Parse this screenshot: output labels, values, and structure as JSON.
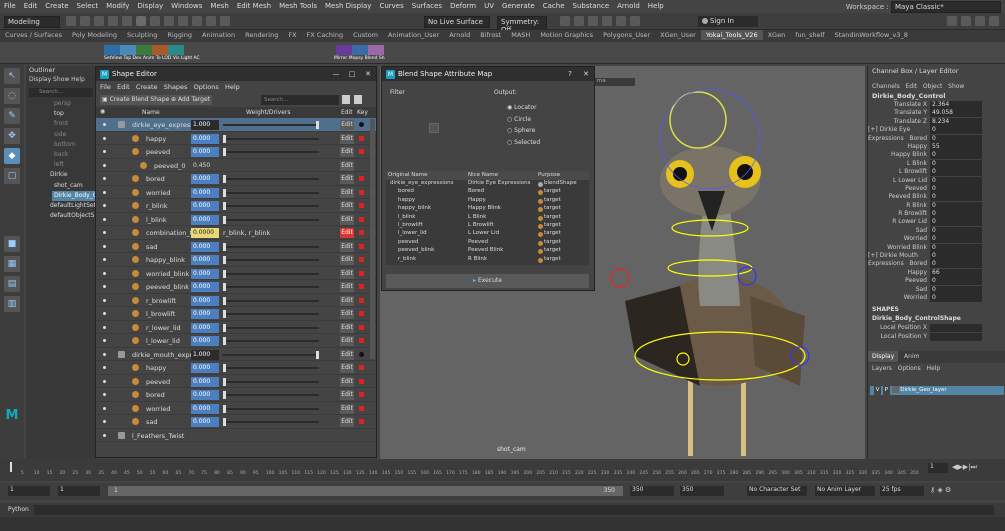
{
  "menubar": {
    "items": [
      "File",
      "Edit",
      "Create",
      "Select",
      "Modify",
      "Display",
      "Windows",
      "Mesh",
      "Edit Mesh",
      "Mesh Tools",
      "Mesh Display",
      "Curves",
      "Surfaces",
      "Deform",
      "UV",
      "Generate",
      "Cache",
      "Substance",
      "Arnold",
      "Help"
    ],
    "workspace_label": "Workspace :",
    "workspace_value": "Maya Classic*"
  },
  "statusline": {
    "mode": "Modeling",
    "live_surface": "No Live Surface",
    "symmetry": "Symmetry: Off",
    "sign_in": "Sign In"
  },
  "shelf_tabs": [
    "Curves / Surfaces",
    "Poly Modeling",
    "Sculpting",
    "Rigging",
    "Animation",
    "Rendering",
    "FX",
    "FX Caching",
    "Custom",
    "Animation_User",
    "Arnold",
    "Bifrost",
    "MASH",
    "Motion Graphics",
    "Polygons_User",
    "XGen_User",
    "Yokai_Tools_V26",
    "XGen",
    "fun_shelf",
    "StandinWorkflow_v3_8"
  ],
  "shelf_active": "Yokai_Tools_V26",
  "shelf_labels": [
    "SetView Top",
    "Dev Anim",
    "To LOD",
    "Vis",
    "Light AC",
    "Mirror",
    "Mopsy",
    "Blend Sh"
  ],
  "outliner": {
    "title": "Outliner",
    "menu": [
      "Display",
      "Show",
      "Help"
    ],
    "search": "Search...",
    "items": [
      "persp",
      "top",
      "front",
      "side",
      "bottom",
      "back",
      "left",
      "Dirkie",
      "shot_cam",
      "Dirkie_Body_C",
      "defaultLightSet",
      "defaultObjectS"
    ]
  },
  "shape_editor": {
    "title": "Shape Editor",
    "menu": [
      "File",
      "Edit",
      "Create",
      "Shapes",
      "Options",
      "Help"
    ],
    "create_btn": "Create Blend Shape",
    "add_target_btn": "Add Target",
    "search": "Search...",
    "col_name": "Name",
    "col_weight": "Weight/Drivers",
    "col_edit": "Edit",
    "col_key": "Key",
    "rows": [
      {
        "name": "dirkie_eye_expressio",
        "weight": "1.000",
        "level": 0,
        "type": "bs"
      },
      {
        "name": "happy",
        "weight": "0.000",
        "level": 1,
        "type": "t"
      },
      {
        "name": "peeved",
        "weight": "0.000",
        "level": 1,
        "type": "t"
      },
      {
        "name": "peeved_0",
        "weight": "0.450",
        "level": 2,
        "type": "ib"
      },
      {
        "name": "bored",
        "weight": "0.000",
        "level": 1,
        "type": "t"
      },
      {
        "name": "worried",
        "weight": "0.000",
        "level": 1,
        "type": "t"
      },
      {
        "name": "r_blink",
        "weight": "0.000",
        "level": 1,
        "type": "t"
      },
      {
        "name": "l_blink",
        "weight": "0.000",
        "level": 1,
        "type": "t"
      },
      {
        "name": "combination_tar",
        "weight": "0.0000",
        "level": 1,
        "type": "c",
        "driver": "r_blink, r_blink"
      },
      {
        "name": "sad",
        "weight": "0.000",
        "level": 1,
        "type": "t"
      },
      {
        "name": "happy_blink",
        "weight": "0.000",
        "level": 1,
        "type": "t"
      },
      {
        "name": "worried_blink",
        "weight": "0.000",
        "level": 1,
        "type": "t"
      },
      {
        "name": "peeved_blink",
        "weight": "0.000",
        "level": 1,
        "type": "t"
      },
      {
        "name": "r_browlift",
        "weight": "0.000",
        "level": 1,
        "type": "t"
      },
      {
        "name": "l_browlift",
        "weight": "0.000",
        "level": 1,
        "type": "t"
      },
      {
        "name": "r_lower_lid",
        "weight": "0.000",
        "level": 1,
        "type": "t"
      },
      {
        "name": "l_lower_lid",
        "weight": "0.000",
        "level": 1,
        "type": "t"
      },
      {
        "name": "dirkie_mouth_expre",
        "weight": "1.000",
        "level": 0,
        "type": "bs"
      },
      {
        "name": "happy",
        "weight": "0.000",
        "level": 1,
        "type": "t"
      },
      {
        "name": "peeved",
        "weight": "0.000",
        "level": 1,
        "type": "t"
      },
      {
        "name": "bored",
        "weight": "0.000",
        "level": 1,
        "type": "t"
      },
      {
        "name": "worried",
        "weight": "0.000",
        "level": 1,
        "type": "t"
      },
      {
        "name": "sad",
        "weight": "0.000",
        "level": 1,
        "type": "t"
      },
      {
        "name": "l_Feathers_Twist",
        "weight": "",
        "level": 0,
        "type": "g"
      }
    ],
    "edit_label": "Edit"
  },
  "bsam": {
    "title": "Blend Shape Attribute Map",
    "filter_label": "Filter",
    "output_label": "Output:",
    "output_options": [
      "Locator",
      "Circle",
      "Sphere",
      "Selected"
    ],
    "table_headers": [
      "Original Name",
      "Nice Name",
      "Purpose"
    ],
    "table_rows": [
      [
        "dirkie_eye_expressions",
        "Dirkie Eye Expressions",
        "blendShape"
      ],
      [
        "bored",
        "Bored",
        "target"
      ],
      [
        "happy",
        "Happy",
        "target"
      ],
      [
        "happy_blink",
        "Happy Blink",
        "target"
      ],
      [
        "l_blink",
        "L Blink",
        "target"
      ],
      [
        "l_browlift",
        "L Browlift",
        "target"
      ],
      [
        "l_lower_lid",
        "L Lower Lid",
        "target"
      ],
      [
        "peeved",
        "Peeved",
        "target"
      ],
      [
        "peeved_blink",
        "Peeved Blink",
        "target"
      ],
      [
        "r_blink",
        "R Blink",
        "target"
      ]
    ],
    "execute_btn": "Execute"
  },
  "viewport": {
    "camera_label": "shot_cam",
    "toolbar_value": "ma"
  },
  "channel_box": {
    "title": "Channel Box / Layer Editor",
    "menu": [
      "Channels",
      "Edit",
      "Object",
      "Show"
    ],
    "object": "Dirkie_Body_Control",
    "channels": [
      [
        "Translate X",
        "2.364"
      ],
      [
        "Translate Y",
        "49.058"
      ],
      [
        "Translate Z",
        "8.234"
      ],
      [
        "[+] Dirkie Eye Expressions",
        "0"
      ],
      [
        "Bored",
        "0"
      ],
      [
        "Happy",
        "55"
      ],
      [
        "Happy Blink",
        "0"
      ],
      [
        "L Blink",
        "0"
      ],
      [
        "L Browlift",
        "0"
      ],
      [
        "L Lower Lid",
        "0"
      ],
      [
        "Peeved",
        "0"
      ],
      [
        "Peeved Blink",
        "0"
      ],
      [
        "R Blink",
        "0"
      ],
      [
        "R Browlift",
        "0"
      ],
      [
        "R Lower Lid",
        "0"
      ],
      [
        "Sad",
        "0"
      ],
      [
        "Worried",
        "0"
      ],
      [
        "Worried Blink",
        "0"
      ],
      [
        "[+] Dirkie Mouth Expressions",
        "0"
      ],
      [
        "Bored",
        "0"
      ],
      [
        "Happy",
        "66"
      ],
      [
        "Peeved",
        "0"
      ],
      [
        "Sad",
        "0"
      ],
      [
        "Worried",
        "0"
      ]
    ],
    "shapes_header": "SHAPES",
    "shape_name": "Dirkie_Body_ControlShape",
    "shape_channels": [
      [
        "Local Position X",
        ""
      ],
      [
        "Local Position Y",
        ""
      ]
    ],
    "layer_tabs": [
      "Display",
      "Anim"
    ],
    "layer_menu": [
      "Layers",
      "Options",
      "Help"
    ],
    "layer_name": "Dirkie_Geo_layer",
    "layer_v": "V",
    "layer_p": "P"
  },
  "timeline": {
    "ticks": [
      "5",
      "10",
      "15",
      "20",
      "25",
      "30",
      "35",
      "40",
      "45",
      "50",
      "55",
      "60",
      "65",
      "70",
      "75",
      "80",
      "85",
      "90",
      "95",
      "100",
      "105",
      "110",
      "115",
      "120",
      "125",
      "130",
      "135",
      "140",
      "145",
      "150",
      "155",
      "160",
      "165",
      "170",
      "175",
      "180",
      "185",
      "190",
      "195",
      "200",
      "205",
      "210",
      "215",
      "220",
      "225",
      "230",
      "235",
      "240",
      "245",
      "250",
      "255",
      "260",
      "265",
      "270",
      "275",
      "280",
      "285",
      "290",
      "295",
      "300",
      "305",
      "310",
      "315",
      "320",
      "325",
      "330",
      "335",
      "340",
      "345",
      "350"
    ],
    "current_frame": "1"
  },
  "range": {
    "start": "1",
    "start2": "1",
    "range_start": "1",
    "range_end": "350",
    "end1": "350",
    "end2": "350",
    "character": "No Character Set",
    "anim_layer": "No Anim Layer",
    "fps": "25 fps"
  },
  "python_label": "Python"
}
